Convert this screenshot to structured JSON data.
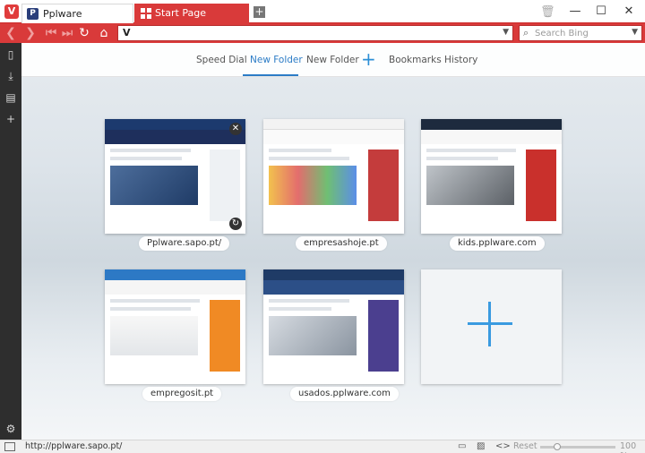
{
  "tabs": [
    {
      "title": "Pplware",
      "favicon_letter": "P"
    },
    {
      "title": "Start Page"
    }
  ],
  "address": {
    "url_value": "",
    "logo_letter": "V"
  },
  "search": {
    "placeholder": "Search Bing"
  },
  "speed_dial_nav": {
    "items": [
      "Speed Dial",
      "New Folder",
      "New Folder",
      "Bookmarks",
      "History"
    ],
    "active_index": 1
  },
  "tiles": [
    {
      "label": "Pplware.sapo.pt/"
    },
    {
      "label": "empresashoje.pt"
    },
    {
      "label": "kids.pplware.com"
    },
    {
      "label": "empregosit.pt"
    },
    {
      "label": "usados.pplware.com"
    }
  ],
  "status": {
    "url": "http://pplware.sapo.pt/",
    "reset_label": "Reset",
    "zoom": "100 %"
  },
  "colors": {
    "accent": "#d93a3a",
    "link_blue": "#2b7cc6"
  }
}
